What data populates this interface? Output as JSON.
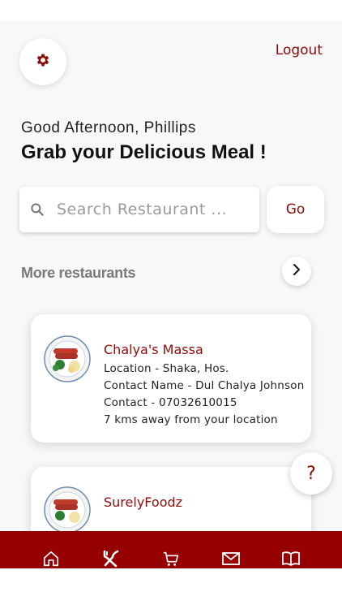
{
  "header": {
    "settings_icon": "gear-icon",
    "logout_label": "Logout"
  },
  "greeting": {
    "line": "Good Afternoon, Phillips",
    "headline": "Grab your Delicious Meal !"
  },
  "search": {
    "placeholder": "Search Restaurant ...",
    "value": "",
    "go_label": "Go"
  },
  "section": {
    "title": "More restaurants",
    "more_icon": "chevron-right-icon"
  },
  "restaurants": [
    {
      "name": "Chalya's Massa",
      "location": "Location - Shaka, Hos.",
      "contact_name": "Contact Name - Dul Chalya Johnson",
      "contact": "Contact - 07032610015",
      "distance": "7 kms away from your location"
    },
    {
      "name": "SurelyFoodz"
    }
  ],
  "help": {
    "label": "?"
  },
  "nav": {
    "items": [
      "home-icon",
      "utensils-icon",
      "cart-icon",
      "mail-icon",
      "book-icon"
    ]
  },
  "colors": {
    "accent": "#8e0a0a",
    "nav_bg": "#970000"
  }
}
